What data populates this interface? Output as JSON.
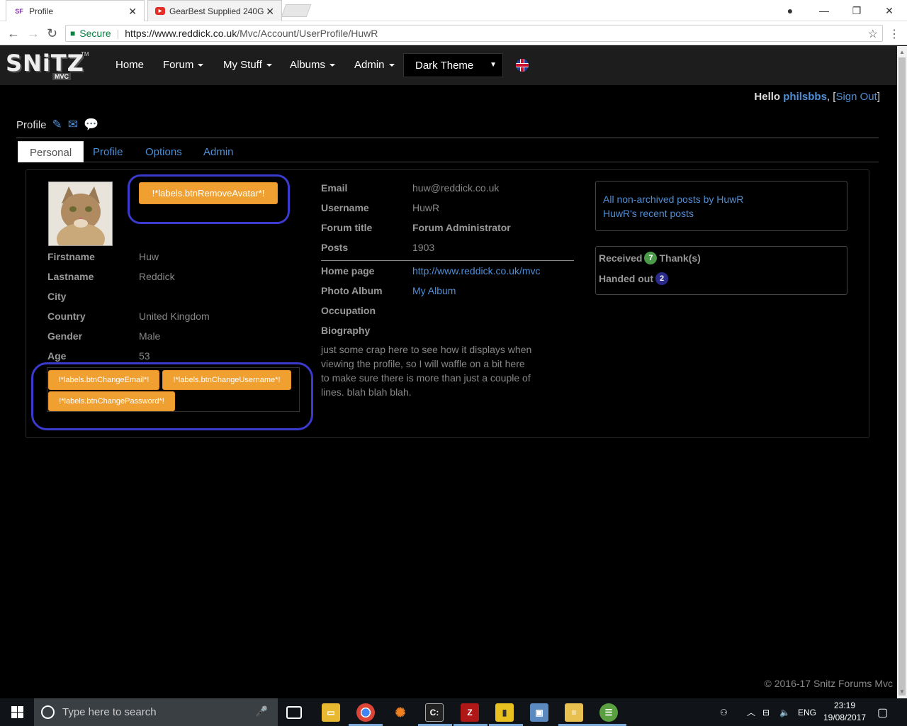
{
  "browser": {
    "tabs": [
      {
        "favicon": "SF",
        "title": "Profile",
        "active": true
      },
      {
        "favicon": "▶",
        "title": "GearBest Supplied 240G",
        "active": false
      }
    ],
    "secure_label": "Secure",
    "url_prefix": "https://www.reddick.co.uk",
    "url_path": "/Mvc/Account/UserProfile/HuwR"
  },
  "navbar": {
    "logo_text": "SNiTZ",
    "logo_sub": "MVC",
    "logo_tm": "TM",
    "items": [
      {
        "label": "Home",
        "dropdown": false
      },
      {
        "label": "Forum",
        "dropdown": true
      },
      {
        "label": "My Stuff",
        "dropdown": true
      },
      {
        "label": "Albums",
        "dropdown": true
      },
      {
        "label": "Admin",
        "dropdown": true
      }
    ],
    "theme": "Dark Theme"
  },
  "header": {
    "hello": "Hello",
    "username": "philsbbs",
    "comma": ",",
    "open_bracket": "[",
    "signout": "Sign Out",
    "close_bracket": "]"
  },
  "page": {
    "title": "Profile",
    "tabs": [
      "Personal",
      "Profile",
      "Options",
      "Admin"
    ]
  },
  "personal": {
    "remove_avatar": "!*labels.btnRemoveAvatar*!",
    "fields": [
      {
        "label": "Firstname",
        "value": "Huw"
      },
      {
        "label": "Lastname",
        "value": "Reddick"
      },
      {
        "label": "City",
        "value": ""
      },
      {
        "label": "Country",
        "value": "United Kingdom"
      },
      {
        "label": "Gender",
        "value": "Male"
      },
      {
        "label": "Age",
        "value": "53"
      }
    ],
    "btn_change_email": "!*labels.btnChangeEmail*!",
    "btn_change_username": "!*labels.btnChangeUsername*!",
    "btn_change_password": "!*labels.btnChangePassword*!"
  },
  "account": {
    "fields": [
      {
        "label": "Email",
        "value": "huw@reddick.co.uk"
      },
      {
        "label": "Username",
        "value": "HuwR"
      },
      {
        "label": "Forum title",
        "value": "Forum Administrator"
      },
      {
        "label": "Posts",
        "value": "1903"
      }
    ],
    "homepage_label": "Home page",
    "homepage_url": "http://www.reddick.co.uk/mvc",
    "album_label": "Photo Album",
    "album_link": "My Album",
    "occupation_label": "Occupation",
    "biography_label": "Biography",
    "biography": "just some crap here to see how it displays when viewing the profile, so I will waffle on a bit here to make sure there is more than just a couple of lines. blah blah blah."
  },
  "side": {
    "links": [
      "All non-archived posts by HuwR",
      "HuwR's recent posts"
    ],
    "received_label": "Received",
    "received_count": "7",
    "thanks_label": "Thank(s)",
    "handed_label": "Handed out",
    "handed_count": "2"
  },
  "footer": "© 2016-17 Snitz Forums Mvc",
  "taskbar": {
    "search_placeholder": "Type here to search",
    "language": "ENG",
    "time": "23:19",
    "date": "19/08/2017"
  },
  "colors": {
    "accent_link": "#4f8fd6",
    "button_orange": "#f0a030",
    "annotation_circle": "#3a3acc",
    "badge_green": "#4a9a4a",
    "badge_navy": "#2a2a8a"
  }
}
